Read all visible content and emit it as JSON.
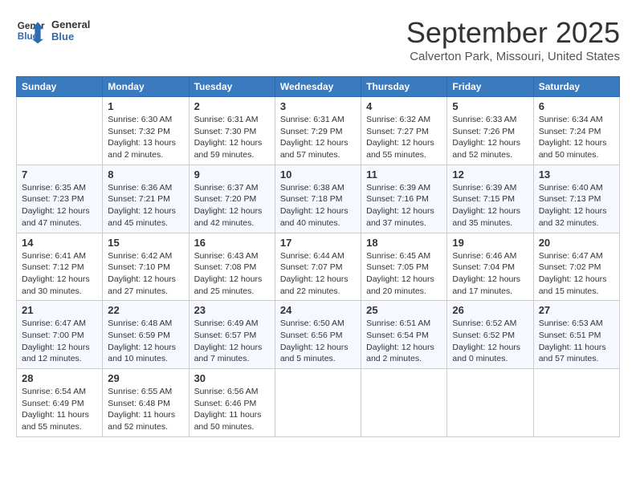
{
  "header": {
    "logo_line1": "General",
    "logo_line2": "Blue",
    "month": "September 2025",
    "location": "Calverton Park, Missouri, United States"
  },
  "weekdays": [
    "Sunday",
    "Monday",
    "Tuesday",
    "Wednesday",
    "Thursday",
    "Friday",
    "Saturday"
  ],
  "weeks": [
    [
      {
        "day": "",
        "sunrise": "",
        "sunset": "",
        "daylight": ""
      },
      {
        "day": "1",
        "sunrise": "Sunrise: 6:30 AM",
        "sunset": "Sunset: 7:32 PM",
        "daylight": "Daylight: 13 hours and 2 minutes."
      },
      {
        "day": "2",
        "sunrise": "Sunrise: 6:31 AM",
        "sunset": "Sunset: 7:30 PM",
        "daylight": "Daylight: 12 hours and 59 minutes."
      },
      {
        "day": "3",
        "sunrise": "Sunrise: 6:31 AM",
        "sunset": "Sunset: 7:29 PM",
        "daylight": "Daylight: 12 hours and 57 minutes."
      },
      {
        "day": "4",
        "sunrise": "Sunrise: 6:32 AM",
        "sunset": "Sunset: 7:27 PM",
        "daylight": "Daylight: 12 hours and 55 minutes."
      },
      {
        "day": "5",
        "sunrise": "Sunrise: 6:33 AM",
        "sunset": "Sunset: 7:26 PM",
        "daylight": "Daylight: 12 hours and 52 minutes."
      },
      {
        "day": "6",
        "sunrise": "Sunrise: 6:34 AM",
        "sunset": "Sunset: 7:24 PM",
        "daylight": "Daylight: 12 hours and 50 minutes."
      }
    ],
    [
      {
        "day": "7",
        "sunrise": "Sunrise: 6:35 AM",
        "sunset": "Sunset: 7:23 PM",
        "daylight": "Daylight: 12 hours and 47 minutes."
      },
      {
        "day": "8",
        "sunrise": "Sunrise: 6:36 AM",
        "sunset": "Sunset: 7:21 PM",
        "daylight": "Daylight: 12 hours and 45 minutes."
      },
      {
        "day": "9",
        "sunrise": "Sunrise: 6:37 AM",
        "sunset": "Sunset: 7:20 PM",
        "daylight": "Daylight: 12 hours and 42 minutes."
      },
      {
        "day": "10",
        "sunrise": "Sunrise: 6:38 AM",
        "sunset": "Sunset: 7:18 PM",
        "daylight": "Daylight: 12 hours and 40 minutes."
      },
      {
        "day": "11",
        "sunrise": "Sunrise: 6:39 AM",
        "sunset": "Sunset: 7:16 PM",
        "daylight": "Daylight: 12 hours and 37 minutes."
      },
      {
        "day": "12",
        "sunrise": "Sunrise: 6:39 AM",
        "sunset": "Sunset: 7:15 PM",
        "daylight": "Daylight: 12 hours and 35 minutes."
      },
      {
        "day": "13",
        "sunrise": "Sunrise: 6:40 AM",
        "sunset": "Sunset: 7:13 PM",
        "daylight": "Daylight: 12 hours and 32 minutes."
      }
    ],
    [
      {
        "day": "14",
        "sunrise": "Sunrise: 6:41 AM",
        "sunset": "Sunset: 7:12 PM",
        "daylight": "Daylight: 12 hours and 30 minutes."
      },
      {
        "day": "15",
        "sunrise": "Sunrise: 6:42 AM",
        "sunset": "Sunset: 7:10 PM",
        "daylight": "Daylight: 12 hours and 27 minutes."
      },
      {
        "day": "16",
        "sunrise": "Sunrise: 6:43 AM",
        "sunset": "Sunset: 7:08 PM",
        "daylight": "Daylight: 12 hours and 25 minutes."
      },
      {
        "day": "17",
        "sunrise": "Sunrise: 6:44 AM",
        "sunset": "Sunset: 7:07 PM",
        "daylight": "Daylight: 12 hours and 22 minutes."
      },
      {
        "day": "18",
        "sunrise": "Sunrise: 6:45 AM",
        "sunset": "Sunset: 7:05 PM",
        "daylight": "Daylight: 12 hours and 20 minutes."
      },
      {
        "day": "19",
        "sunrise": "Sunrise: 6:46 AM",
        "sunset": "Sunset: 7:04 PM",
        "daylight": "Daylight: 12 hours and 17 minutes."
      },
      {
        "day": "20",
        "sunrise": "Sunrise: 6:47 AM",
        "sunset": "Sunset: 7:02 PM",
        "daylight": "Daylight: 12 hours and 15 minutes."
      }
    ],
    [
      {
        "day": "21",
        "sunrise": "Sunrise: 6:47 AM",
        "sunset": "Sunset: 7:00 PM",
        "daylight": "Daylight: 12 hours and 12 minutes."
      },
      {
        "day": "22",
        "sunrise": "Sunrise: 6:48 AM",
        "sunset": "Sunset: 6:59 PM",
        "daylight": "Daylight: 12 hours and 10 minutes."
      },
      {
        "day": "23",
        "sunrise": "Sunrise: 6:49 AM",
        "sunset": "Sunset: 6:57 PM",
        "daylight": "Daylight: 12 hours and 7 minutes."
      },
      {
        "day": "24",
        "sunrise": "Sunrise: 6:50 AM",
        "sunset": "Sunset: 6:56 PM",
        "daylight": "Daylight: 12 hours and 5 minutes."
      },
      {
        "day": "25",
        "sunrise": "Sunrise: 6:51 AM",
        "sunset": "Sunset: 6:54 PM",
        "daylight": "Daylight: 12 hours and 2 minutes."
      },
      {
        "day": "26",
        "sunrise": "Sunrise: 6:52 AM",
        "sunset": "Sunset: 6:52 PM",
        "daylight": "Daylight: 12 hours and 0 minutes."
      },
      {
        "day": "27",
        "sunrise": "Sunrise: 6:53 AM",
        "sunset": "Sunset: 6:51 PM",
        "daylight": "Daylight: 11 hours and 57 minutes."
      }
    ],
    [
      {
        "day": "28",
        "sunrise": "Sunrise: 6:54 AM",
        "sunset": "Sunset: 6:49 PM",
        "daylight": "Daylight: 11 hours and 55 minutes."
      },
      {
        "day": "29",
        "sunrise": "Sunrise: 6:55 AM",
        "sunset": "Sunset: 6:48 PM",
        "daylight": "Daylight: 11 hours and 52 minutes."
      },
      {
        "day": "30",
        "sunrise": "Sunrise: 6:56 AM",
        "sunset": "Sunset: 6:46 PM",
        "daylight": "Daylight: 11 hours and 50 minutes."
      },
      {
        "day": "",
        "sunrise": "",
        "sunset": "",
        "daylight": ""
      },
      {
        "day": "",
        "sunrise": "",
        "sunset": "",
        "daylight": ""
      },
      {
        "day": "",
        "sunrise": "",
        "sunset": "",
        "daylight": ""
      },
      {
        "day": "",
        "sunrise": "",
        "sunset": "",
        "daylight": ""
      }
    ]
  ]
}
